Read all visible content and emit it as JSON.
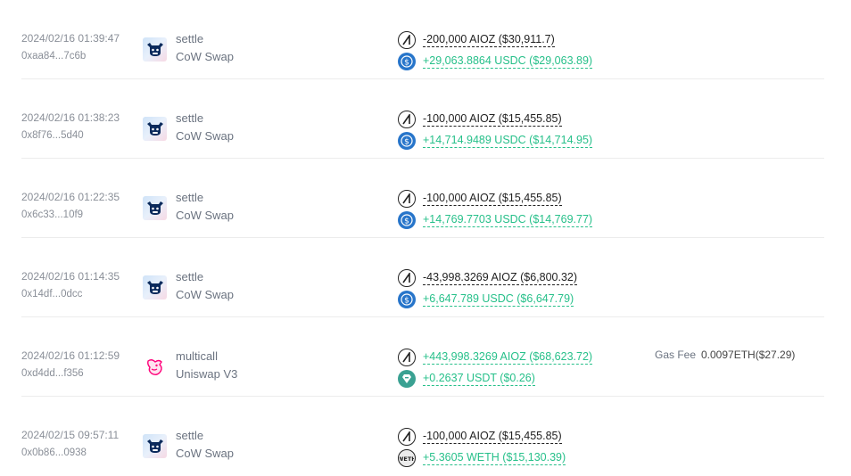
{
  "transactions": [
    {
      "time": "2024/02/16 01:39:47",
      "hash": "0xaa84...7c6b",
      "method": "settle",
      "protocol": "CoW Swap",
      "protocol_icon": "cow-icon",
      "tokens": [
        {
          "icon": "aioz-icon",
          "amount": "-200,000 AIOZ ($30,911.7)",
          "direction": "out"
        },
        {
          "icon": "usdc-icon",
          "amount": "+29,063.8864 USDC ($29,063.89)",
          "direction": "in"
        }
      ]
    },
    {
      "time": "2024/02/16 01:38:23",
      "hash": "0x8f76...5d40",
      "method": "settle",
      "protocol": "CoW Swap",
      "protocol_icon": "cow-icon",
      "tokens": [
        {
          "icon": "aioz-icon",
          "amount": "-100,000 AIOZ ($15,455.85)",
          "direction": "out"
        },
        {
          "icon": "usdc-icon",
          "amount": "+14,714.9489 USDC ($14,714.95)",
          "direction": "in"
        }
      ]
    },
    {
      "time": "2024/02/16 01:22:35",
      "hash": "0x6c33...10f9",
      "method": "settle",
      "protocol": "CoW Swap",
      "protocol_icon": "cow-icon",
      "tokens": [
        {
          "icon": "aioz-icon",
          "amount": "-100,000 AIOZ ($15,455.85)",
          "direction": "out"
        },
        {
          "icon": "usdc-icon",
          "amount": "+14,769.7703 USDC ($14,769.77)",
          "direction": "in"
        }
      ]
    },
    {
      "time": "2024/02/16 01:14:35",
      "hash": "0x14df...0dcc",
      "method": "settle",
      "protocol": "CoW Swap",
      "protocol_icon": "cow-icon",
      "tokens": [
        {
          "icon": "aioz-icon",
          "amount": "-43,998.3269 AIOZ ($6,800.32)",
          "direction": "out"
        },
        {
          "icon": "usdc-icon",
          "amount": "+6,647.789 USDC ($6,647.79)",
          "direction": "in"
        }
      ]
    },
    {
      "time": "2024/02/16 01:12:59",
      "hash": "0xd4dd...f356",
      "method": "multicall",
      "protocol": "Uniswap V3",
      "protocol_icon": "unicorn-icon",
      "tokens": [
        {
          "icon": "aioz-icon",
          "amount": "+443,998.3269 AIOZ ($68,623.72)",
          "direction": "in"
        },
        {
          "icon": "usdt-icon",
          "amount": "+0.2637 USDT ($0.26)",
          "direction": "in"
        }
      ],
      "gas_label": "Gas Fee",
      "gas_value": "0.0097ETH($27.29)"
    },
    {
      "time": "2024/02/15 09:57:11",
      "hash": "0x0b86...0938",
      "method": "settle",
      "protocol": "CoW Swap",
      "protocol_icon": "cow-icon",
      "tokens": [
        {
          "icon": "aioz-icon",
          "amount": "-100,000 AIOZ ($15,455.85)",
          "direction": "out"
        },
        {
          "icon": "weth-icon",
          "amount": "+5.3605 WETH ($15,130.39)",
          "direction": "in"
        }
      ]
    }
  ],
  "colors": {
    "positive": "#27c08a",
    "negative": "#222222",
    "muted": "#8a8f98",
    "divider": "#ececec"
  }
}
